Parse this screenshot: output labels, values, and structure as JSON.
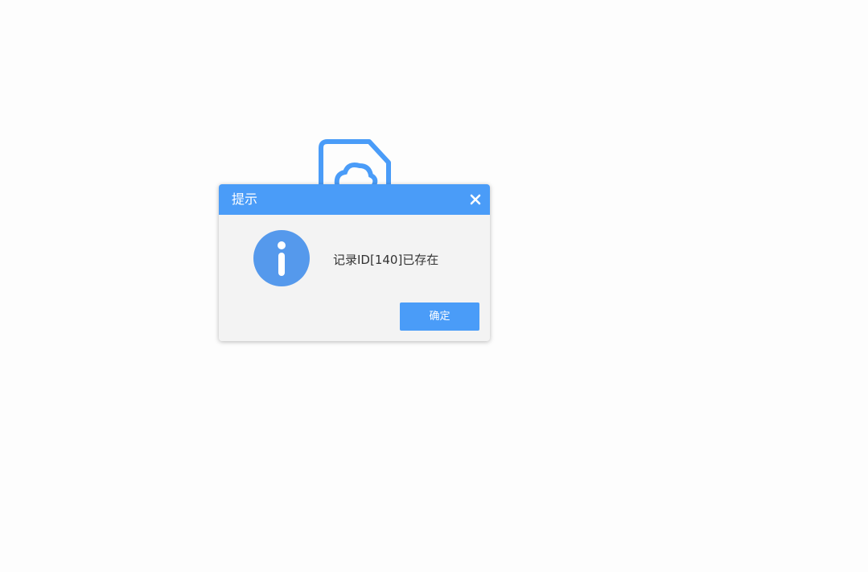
{
  "dialog": {
    "title": "提示",
    "close_icon": "close-icon",
    "message_icon": "info-icon",
    "message": "记录ID[140]已存在",
    "ok_label": "确定"
  },
  "background": {
    "logo_icon": "cloud-document-icon"
  },
  "colors": {
    "accent": "#4a9cf8",
    "dialog_body": "#f3f3f3",
    "message_text": "#333333",
    "icon_blue": "#5599ec"
  }
}
